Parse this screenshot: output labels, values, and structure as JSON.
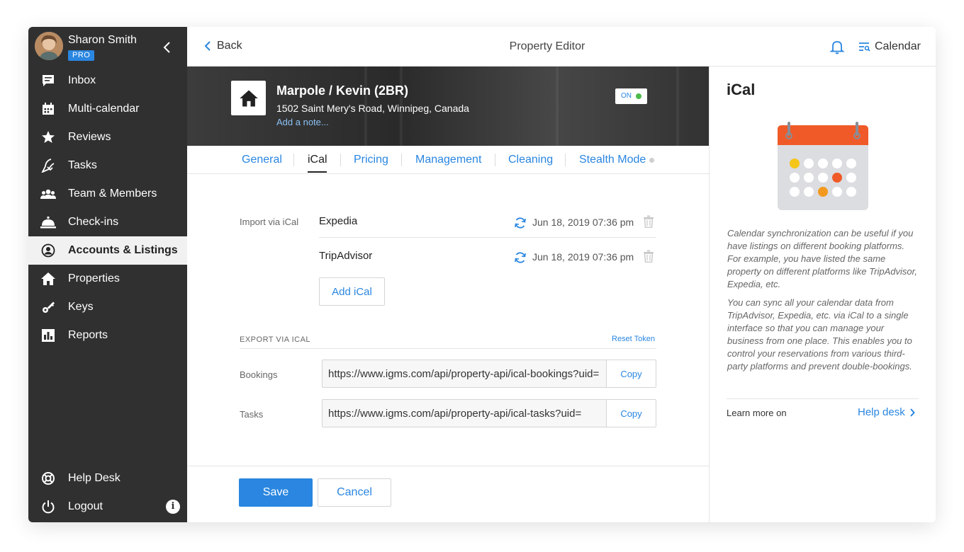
{
  "sidebar": {
    "user_name": "Sharon Smith",
    "badge": "PRO",
    "items": [
      {
        "label": "Inbox",
        "icon": "inbox-icon"
      },
      {
        "label": "Multi-calendar",
        "icon": "calendar-icon"
      },
      {
        "label": "Reviews",
        "icon": "star-icon"
      },
      {
        "label": "Tasks",
        "icon": "broom-icon"
      },
      {
        "label": "Team & Members",
        "icon": "team-icon"
      },
      {
        "label": "Check-ins",
        "icon": "bell-desk-icon"
      },
      {
        "label": "Accounts & Listings",
        "icon": "account-icon"
      },
      {
        "label": "Properties",
        "icon": "home-icon"
      },
      {
        "label": "Keys",
        "icon": "key-icon"
      },
      {
        "label": "Reports",
        "icon": "bar-chart-icon"
      }
    ],
    "active_item": "Accounts & Listings",
    "bottom": [
      {
        "label": "Help Desk",
        "icon": "lifebuoy-icon"
      },
      {
        "label": "Logout",
        "icon": "power-icon"
      }
    ],
    "info": "i"
  },
  "topbar": {
    "back": "Back",
    "title": "Property Editor",
    "calendar": "Calendar"
  },
  "property": {
    "name": "Marpole / Kevin (2BR)",
    "address": "1502 Saint Mery's Road, Winnipeg, Canada",
    "note_link": "Add a note...",
    "status": "ON"
  },
  "tabs": [
    "General",
    "iCal",
    "Pricing",
    "Management",
    "Cleaning",
    "Stealth Mode"
  ],
  "active_tab": "iCal",
  "import": {
    "label": "Import via iCal",
    "sources": [
      {
        "name": "Expedia",
        "synced": "Jun 18, 2019 07:36 pm"
      },
      {
        "name": "TripAdvisor",
        "synced": "Jun 18, 2019 07:36 pm"
      }
    ],
    "add_button": "Add iCal"
  },
  "export": {
    "heading": "EXPORT VIA ICAL",
    "reset": "Reset Token",
    "rows": [
      {
        "label": "Bookings",
        "url": "https://www.igms.com/api/property-api/ical-bookings?uid=",
        "copy": "Copy"
      },
      {
        "label": "Tasks",
        "url": "https://www.igms.com/api/property-api/ical-tasks?uid=",
        "copy": "Copy"
      }
    ]
  },
  "actions": {
    "save": "Save",
    "cancel": "Cancel"
  },
  "panel": {
    "title": "iCal",
    "paragraph1": "Calendar synchronization can be useful if you have listings on different booking platforms. For example, you have listed the same property on different platforms like TripAdvisor, Expedia, etc.",
    "paragraph2": "You can sync all your calendar data from TripAdvisor, Expedia, etc. via iCal to a single interface so that you can manage your business from one place. This enables you to control your reservations from various third-party platforms and prevent double-bookings.",
    "learn_more": "Learn more on",
    "help_link": "Help desk"
  },
  "colors": {
    "accent": "#2a86e0",
    "sidebar": "#303030",
    "calendar_header": "#f05a28",
    "calendar_yellow": "#f5c518",
    "calendar_orange": "#f39a1e",
    "status_on": "#4cbb4c"
  }
}
